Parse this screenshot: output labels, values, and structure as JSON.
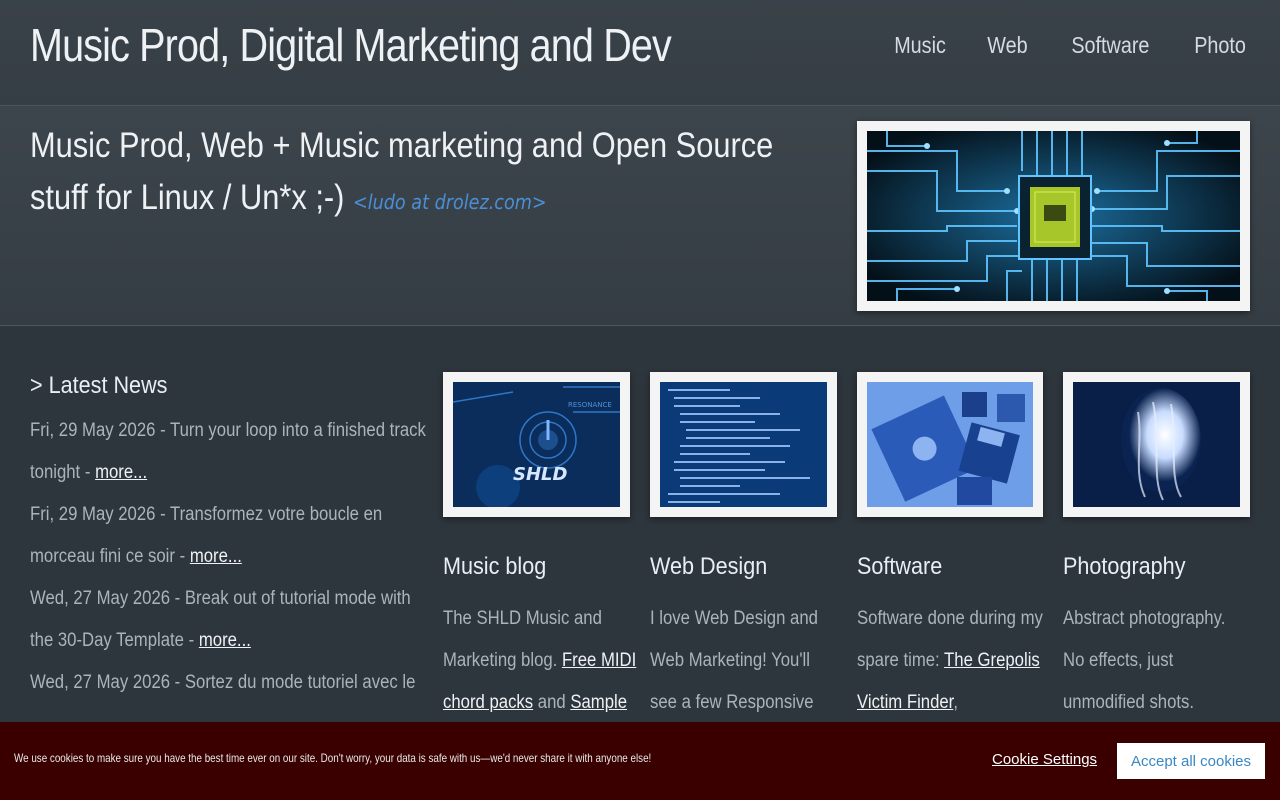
{
  "header": {
    "site_title": "Music Prod, Digital Marketing and Dev",
    "nav": [
      "Music",
      "Web",
      "Software",
      "Photo"
    ]
  },
  "hero": {
    "tagline": "Music Prod, Web + Music marketing and Open Source stuff for Linux / Un*x ;-)",
    "email": "<ludo at drolez.com>"
  },
  "news": {
    "heading": "> Latest News",
    "items": [
      {
        "text": "Fri, 29 May 2026 - Turn your loop into a finished track tonight - ",
        "link": "more..."
      },
      {
        "text": "Fri, 29 May 2026 - Transformez votre boucle en morceau fini ce soir - ",
        "link": "more..."
      },
      {
        "text": "Wed, 27 May 2026 - Break out of tutorial mode with the 30-Day Template - ",
        "link": "more..."
      },
      {
        "text": "Wed, 27 May 2026 - Sortez du mode tutoriel avec le",
        "link": ""
      }
    ]
  },
  "cards": [
    {
      "title": "Music blog",
      "desc_before": "The SHLD Music and Marketing blog. ",
      "link1": "Free MIDI chord packs",
      "mid": " and ",
      "link2": "Sample",
      "after": ""
    },
    {
      "title": "Web Design",
      "desc_before": "I love Web Design and Web Marketing! You'll see a few Responsive",
      "link1": "",
      "mid": "",
      "link2": "",
      "after": ""
    },
    {
      "title": "Software",
      "desc_before": "Software done during my spare time: ",
      "link1": "The Grepolis Victim Finder",
      "mid": ",",
      "link2": "",
      "after": ""
    },
    {
      "title": "Photography",
      "desc_before": "Abstract photography. No effects, just unmodified shots.",
      "link1": "",
      "mid": "",
      "link2": "",
      "after": ""
    }
  ],
  "cookie": {
    "text": "We use cookies to make sure you have the best time ever on our site. Don't worry, your data is safe with us—we'd never share it with anyone else!",
    "settings": "Cookie Settings",
    "accept": "Accept all cookies"
  },
  "colors": {
    "background": "#2e363d",
    "email": "#4a8fd8",
    "cookie_bar": "#3a0000",
    "accept_text": "#3a87c2"
  }
}
